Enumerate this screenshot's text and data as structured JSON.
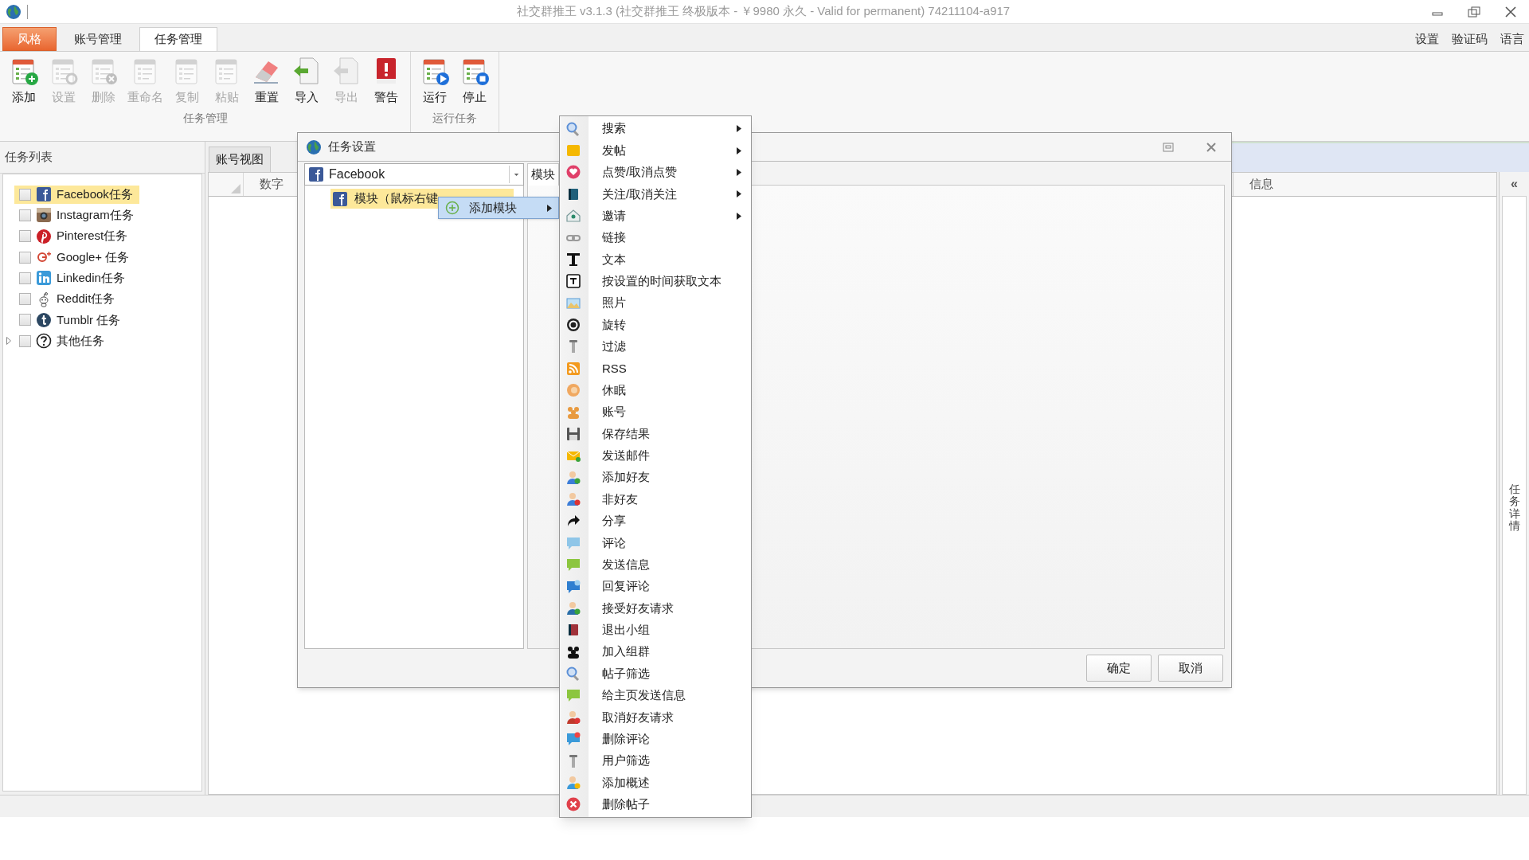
{
  "window": {
    "title": "社交群推王 v3.1.3 (社交群推王 终极版本 - ￥9980 永久 - Valid for permanent) 74211104-a917"
  },
  "ribbon_tabs": [
    {
      "label": "风格",
      "kind": "application",
      "selected": false
    },
    {
      "label": "账号管理",
      "kind": "tab",
      "selected": false
    },
    {
      "label": "任务管理",
      "kind": "tab",
      "selected": true
    }
  ],
  "top_links": [
    "设置",
    "验证码",
    "语言"
  ],
  "ribbon_groups": [
    {
      "label": "任务管理",
      "buttons": [
        {
          "label": "添加",
          "disabled": false
        },
        {
          "label": "设置",
          "disabled": true
        },
        {
          "label": "删除",
          "disabled": true
        },
        {
          "label": "重命名",
          "disabled": true
        },
        {
          "label": "复制",
          "disabled": true
        },
        {
          "label": "粘贴",
          "disabled": true
        },
        {
          "label": "重置",
          "disabled": false
        },
        {
          "label": "导入",
          "disabled": false
        },
        {
          "label": "导出",
          "disabled": true
        },
        {
          "label": "警告",
          "disabled": false
        }
      ]
    },
    {
      "label": "运行任务",
      "buttons": [
        {
          "label": "运行",
          "disabled": false
        },
        {
          "label": "停止",
          "disabled": false
        }
      ]
    }
  ],
  "task_list": {
    "title": "任务列表",
    "items": [
      {
        "label": "Facebook任务",
        "checked": false,
        "selected": true,
        "expandable": false
      },
      {
        "label": "Instagram任务",
        "checked": false,
        "selected": false,
        "expandable": false
      },
      {
        "label": "Pinterest任务",
        "checked": false,
        "selected": false,
        "expandable": false
      },
      {
        "label": "Google+ 任务",
        "checked": false,
        "selected": false,
        "expandable": false
      },
      {
        "label": "Linkedin任务",
        "checked": false,
        "selected": false,
        "expandable": false
      },
      {
        "label": "Reddit任务",
        "checked": false,
        "selected": false,
        "expandable": false
      },
      {
        "label": "Tumblr 任务",
        "checked": false,
        "selected": false,
        "expandable": false
      },
      {
        "label": "其他任务",
        "checked": false,
        "selected": false,
        "expandable": true
      }
    ]
  },
  "view_tabs": [
    {
      "label": "账号视图",
      "selected": true
    }
  ],
  "grid": {
    "columns": [
      "数字",
      "信息"
    ]
  },
  "side_panel": {
    "collapse_glyph": "«",
    "title": "任务详情"
  },
  "dialog": {
    "title": "任务设置",
    "platform": "Facebook",
    "tree_item": {
      "label": "模块（鼠标右键",
      "selected": true
    },
    "popup_item": "添加模块",
    "tab": "模块",
    "buttons": [
      "确定",
      "取消"
    ]
  },
  "menu": [
    {
      "label": "搜索",
      "submenu": true
    },
    {
      "label": "发帖",
      "submenu": true
    },
    {
      "label": "点赞/取消点赞",
      "submenu": true
    },
    {
      "label": "关注/取消关注",
      "submenu": true
    },
    {
      "label": "邀请",
      "submenu": true
    },
    {
      "label": "链接",
      "submenu": false
    },
    {
      "label": "文本",
      "submenu": false
    },
    {
      "label": "按设置的时间获取文本",
      "submenu": false
    },
    {
      "label": "照片",
      "submenu": false
    },
    {
      "label": "旋转",
      "submenu": false
    },
    {
      "label": "过滤",
      "submenu": false
    },
    {
      "label": "RSS",
      "submenu": false
    },
    {
      "label": "休眠",
      "submenu": false
    },
    {
      "label": "账号",
      "submenu": false
    },
    {
      "label": "保存结果",
      "submenu": false
    },
    {
      "label": "发送邮件",
      "submenu": false
    },
    {
      "label": "添加好友",
      "submenu": false
    },
    {
      "label": "非好友",
      "submenu": false
    },
    {
      "label": "分享",
      "submenu": false
    },
    {
      "label": "评论",
      "submenu": false
    },
    {
      "label": "发送信息",
      "submenu": false
    },
    {
      "label": "回复评论",
      "submenu": false
    },
    {
      "label": "接受好友请求",
      "submenu": false
    },
    {
      "label": "退出小组",
      "submenu": false
    },
    {
      "label": "加入组群",
      "submenu": false
    },
    {
      "label": "帖子筛选",
      "submenu": false
    },
    {
      "label": "给主页发送信息",
      "submenu": false
    },
    {
      "label": "取消好友请求",
      "submenu": false
    },
    {
      "label": "删除评论",
      "submenu": false
    },
    {
      "label": "用户筛选",
      "submenu": false
    },
    {
      "label": "添加概述",
      "submenu": false
    },
    {
      "label": "删除帖子",
      "submenu": false
    }
  ]
}
